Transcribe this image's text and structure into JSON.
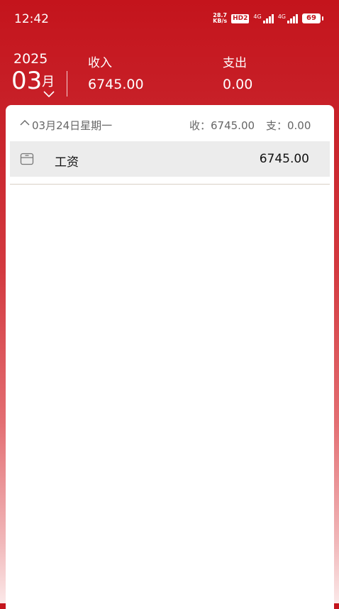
{
  "status_bar": {
    "time": "12:42",
    "net_speed_value": "28.7",
    "net_speed_unit": "KB/s",
    "hd_badge": "HD2",
    "sim1_tag": "4G",
    "sim2_tag": "4G",
    "battery": "69"
  },
  "header": {
    "year": "2025",
    "month": "03",
    "month_unit": "月",
    "income_label": "收入",
    "income_value": "6745.00",
    "expense_label": "支出",
    "expense_value": "0.00"
  },
  "day_group": {
    "date_label": "03月24日星期一",
    "income_summary": "收：6745.00",
    "expense_summary": "支：0.00",
    "records": [
      {
        "category": "工资",
        "amount": "6745.00",
        "icon": "wallet-icon"
      }
    ]
  },
  "colors": {
    "brand_red": "#c4141c",
    "card_bg": "#ffffff",
    "row_bg": "#ececec"
  }
}
